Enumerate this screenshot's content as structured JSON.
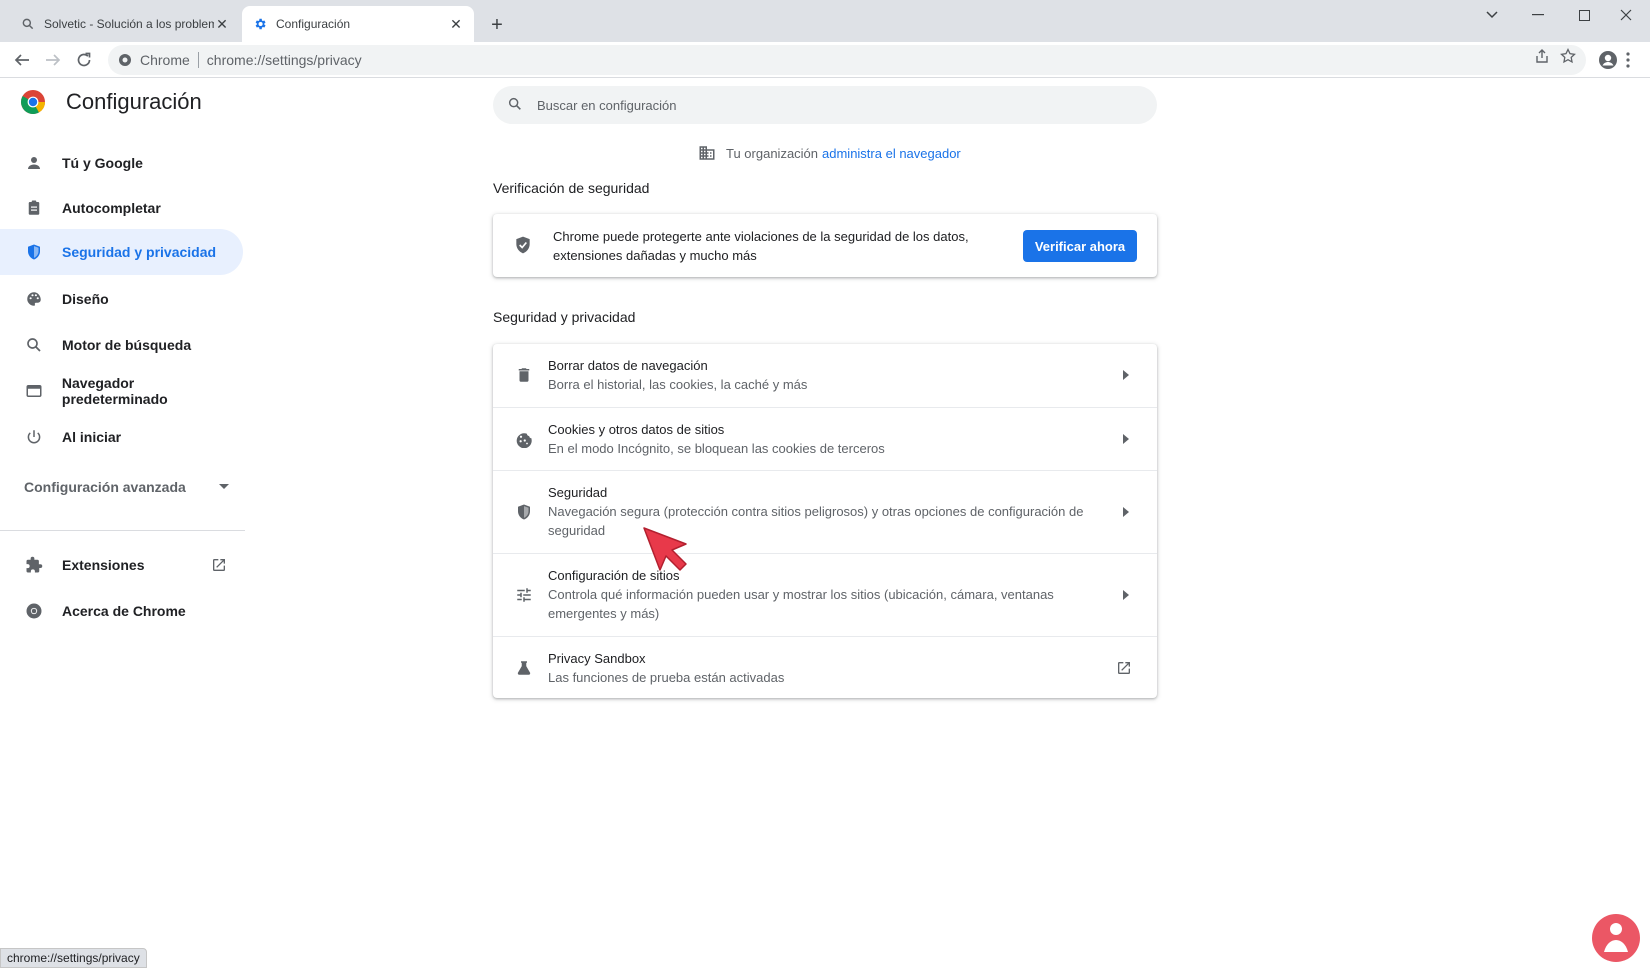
{
  "tabs": [
    {
      "title": "Solvetic - Solución a los problemas",
      "active": false
    },
    {
      "title": "Configuración",
      "active": true
    }
  ],
  "omnibox": {
    "site": "Chrome",
    "url": "chrome://settings/privacy"
  },
  "sidebar": {
    "title": "Configuración",
    "items": [
      {
        "label": "Tú y Google",
        "icon": "person-icon"
      },
      {
        "label": "Autocompletar",
        "icon": "clipboard-icon"
      },
      {
        "label": "Seguridad y privacidad",
        "icon": "shield-icon",
        "selected": true
      },
      {
        "label": "Diseño",
        "icon": "palette-icon"
      },
      {
        "label": "Motor de búsqueda",
        "icon": "search-icon"
      },
      {
        "label": "Navegador predeterminado",
        "icon": "browser-icon"
      },
      {
        "label": "Al iniciar",
        "icon": "power-icon"
      }
    ],
    "advanced": "Configuración avanzada",
    "extensions": "Extensiones",
    "about": "Acerca de Chrome"
  },
  "search": {
    "placeholder": "Buscar en configuración"
  },
  "managed": {
    "text": "Tu organización",
    "link": "administra el navegador"
  },
  "safety_check": {
    "title": "Verificación de seguridad",
    "text": "Chrome puede protegerte ante violaciones de la seguridad de los datos, extensiones dañadas y mucho más",
    "button": "Verificar ahora"
  },
  "privacy": {
    "title": "Seguridad y privacidad",
    "rows": [
      {
        "title": "Borrar datos de navegación",
        "subtitle": "Borra el historial, las cookies, la caché y más",
        "icon": "trash-icon"
      },
      {
        "title": "Cookies y otros datos de sitios",
        "subtitle": "En el modo Incógnito, se bloquean las cookies de terceros",
        "icon": "cookie-icon"
      },
      {
        "title": "Seguridad",
        "subtitle": "Navegación segura (protección contra sitios peligrosos) y otras opciones de configuración de seguridad",
        "icon": "shield-icon"
      },
      {
        "title": "Configuración de sitios",
        "subtitle": "Controla qué información pueden usar y mostrar los sitios (ubicación, cámara, ventanas emergentes y más)",
        "icon": "sliders-icon"
      },
      {
        "title": "Privacy Sandbox",
        "subtitle": "Las funciones de prueba están activadas",
        "icon": "flask-icon"
      }
    ]
  },
  "statusbar": "chrome://settings/privacy",
  "colors": {
    "accent": "#1a73e8",
    "selected_bg": "#e8f0fe",
    "cursor": "#e8394a"
  }
}
